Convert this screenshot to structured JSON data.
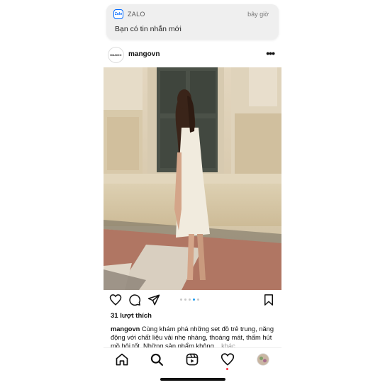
{
  "notification": {
    "app_icon_text": "Zalo",
    "app_name": "ZALO",
    "time": "bây giờ",
    "message": "Bạn có tin nhắn mới"
  },
  "post": {
    "avatar_text": "MANGO",
    "username": "mangovn",
    "more_icon": "more-horizontal-icon",
    "likes": "31 lượt thích",
    "caption_user": "mangovn",
    "caption_text": " Cùng khám phá những set đồ trẻ trung, năng động với chất liệu vải nhẹ nhàng, thoáng mát, thấm hút mồ hôi tốt. Những sản phẩm không...",
    "caption_more": " khác",
    "carousel": {
      "count": 5,
      "active_index": 3
    }
  },
  "icons": {
    "like": "heart-icon",
    "comment": "comment-icon",
    "share": "send-icon",
    "save": "bookmark-icon",
    "nav_home": "home-icon",
    "nav_search": "search-icon",
    "nav_reels": "reels-icon",
    "nav_activity": "heart-icon",
    "nav_profile": "profile-avatar"
  },
  "colors": {
    "notification_bg": "#efefef",
    "zalo_blue": "#0068ff",
    "carousel_active": "#1d9bf0",
    "activity_dot": "#ff3040"
  }
}
